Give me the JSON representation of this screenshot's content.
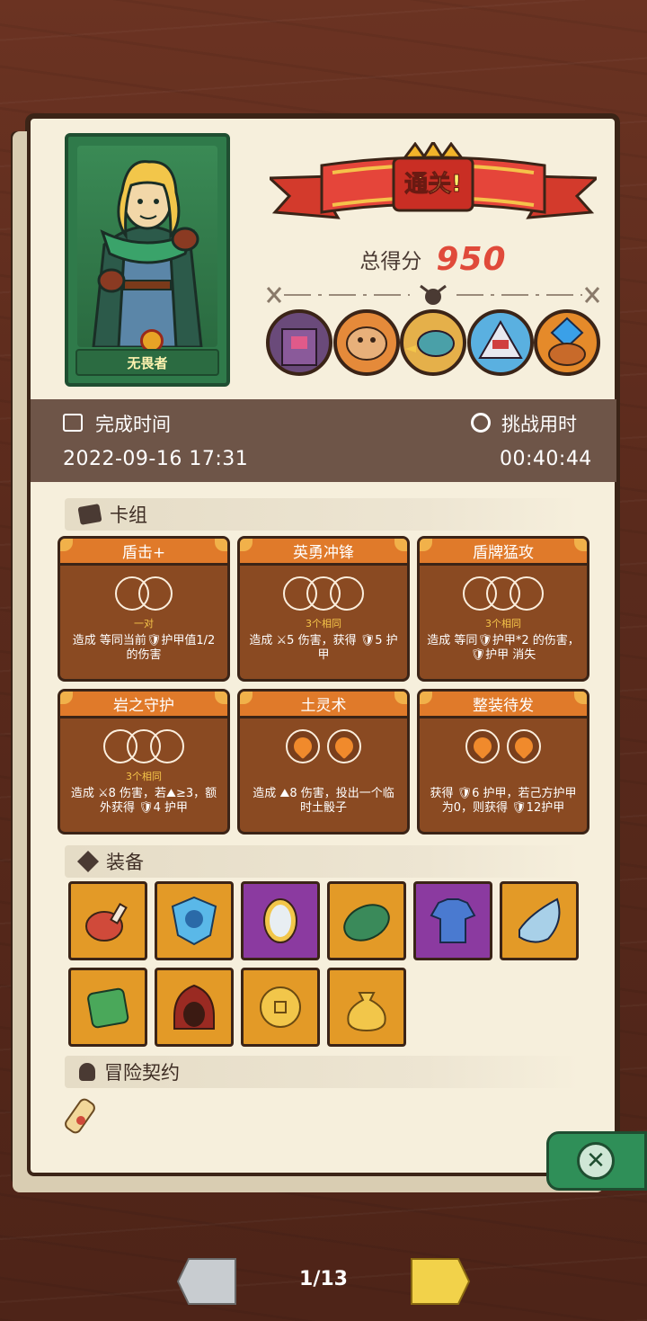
{
  "result": {
    "banner_text": "通关!",
    "score_label": "总得分",
    "score_value": "950"
  },
  "hero": {
    "name": "无畏者"
  },
  "bosses": [
    {
      "icon": "stone-golem-icon"
    },
    {
      "icon": "boar-warrior-icon"
    },
    {
      "icon": "bird-shaman-icon"
    },
    {
      "icon": "ice-beast-icon"
    },
    {
      "icon": "crystal-demon-icon"
    }
  ],
  "time": {
    "finish_label": "完成时间",
    "finish_value": "2022-09-16 17:31",
    "duration_label": "挑战用时",
    "duration_value": "00:40:44"
  },
  "sections": {
    "deck": "卡组",
    "equipment": "装备",
    "contract": "冒险契约"
  },
  "cards": [
    {
      "title": "盾击+",
      "sub": "一对",
      "dice": "rings2",
      "desc": "造成 等同当前🛡护甲值1/2 的伤害"
    },
    {
      "title": "英勇冲锋",
      "sub": "3个相同",
      "dice": "rings3",
      "desc": "造成 ⚔5 伤害，获得 🛡5 护甲"
    },
    {
      "title": "盾牌猛攻",
      "sub": "3个相同",
      "dice": "rings3",
      "desc": "造成 等同🛡护甲*2 的伤害，🛡护甲 消失"
    },
    {
      "title": "岩之守护",
      "sub": "3个相同",
      "dice": "rings3",
      "desc": "造成 ⚔8 伤害，若⛰≥3，额外获得 🛡4 护甲"
    },
    {
      "title": "土灵术",
      "sub": "",
      "dice": "fire2",
      "desc": "造成 ⛰8 伤害，投出一个临时土骰子"
    },
    {
      "title": "整装待发",
      "sub": "",
      "dice": "fire2",
      "desc": "获得 🛡6 护甲，若己方护甲为0，则获得 🛡12护甲"
    }
  ],
  "equipment": [
    {
      "icon": "ham-icon",
      "rarity": "orange"
    },
    {
      "icon": "pumpkin-shield-icon",
      "rarity": "orange"
    },
    {
      "icon": "magic-mirror-icon",
      "rarity": "purple"
    },
    {
      "icon": "turtle-shell-icon",
      "rarity": "orange"
    },
    {
      "icon": "blue-tunic-icon",
      "rarity": "purple"
    },
    {
      "icon": "horn-icon",
      "rarity": "orange"
    },
    {
      "icon": "moss-stone-icon",
      "rarity": "orange"
    },
    {
      "icon": "red-hood-icon",
      "rarity": "orange"
    },
    {
      "icon": "gold-coin-icon",
      "rarity": "orange"
    },
    {
      "icon": "money-bag-icon",
      "rarity": "orange"
    }
  ],
  "contract_icon": "scroll-icon",
  "pager": {
    "text": "1/13"
  },
  "colors": {
    "accent_orange": "#e07a2a",
    "score_red": "#e04a3a",
    "hero_green": "#2f7a4a",
    "purple_rarity": "#8b3aa0"
  }
}
